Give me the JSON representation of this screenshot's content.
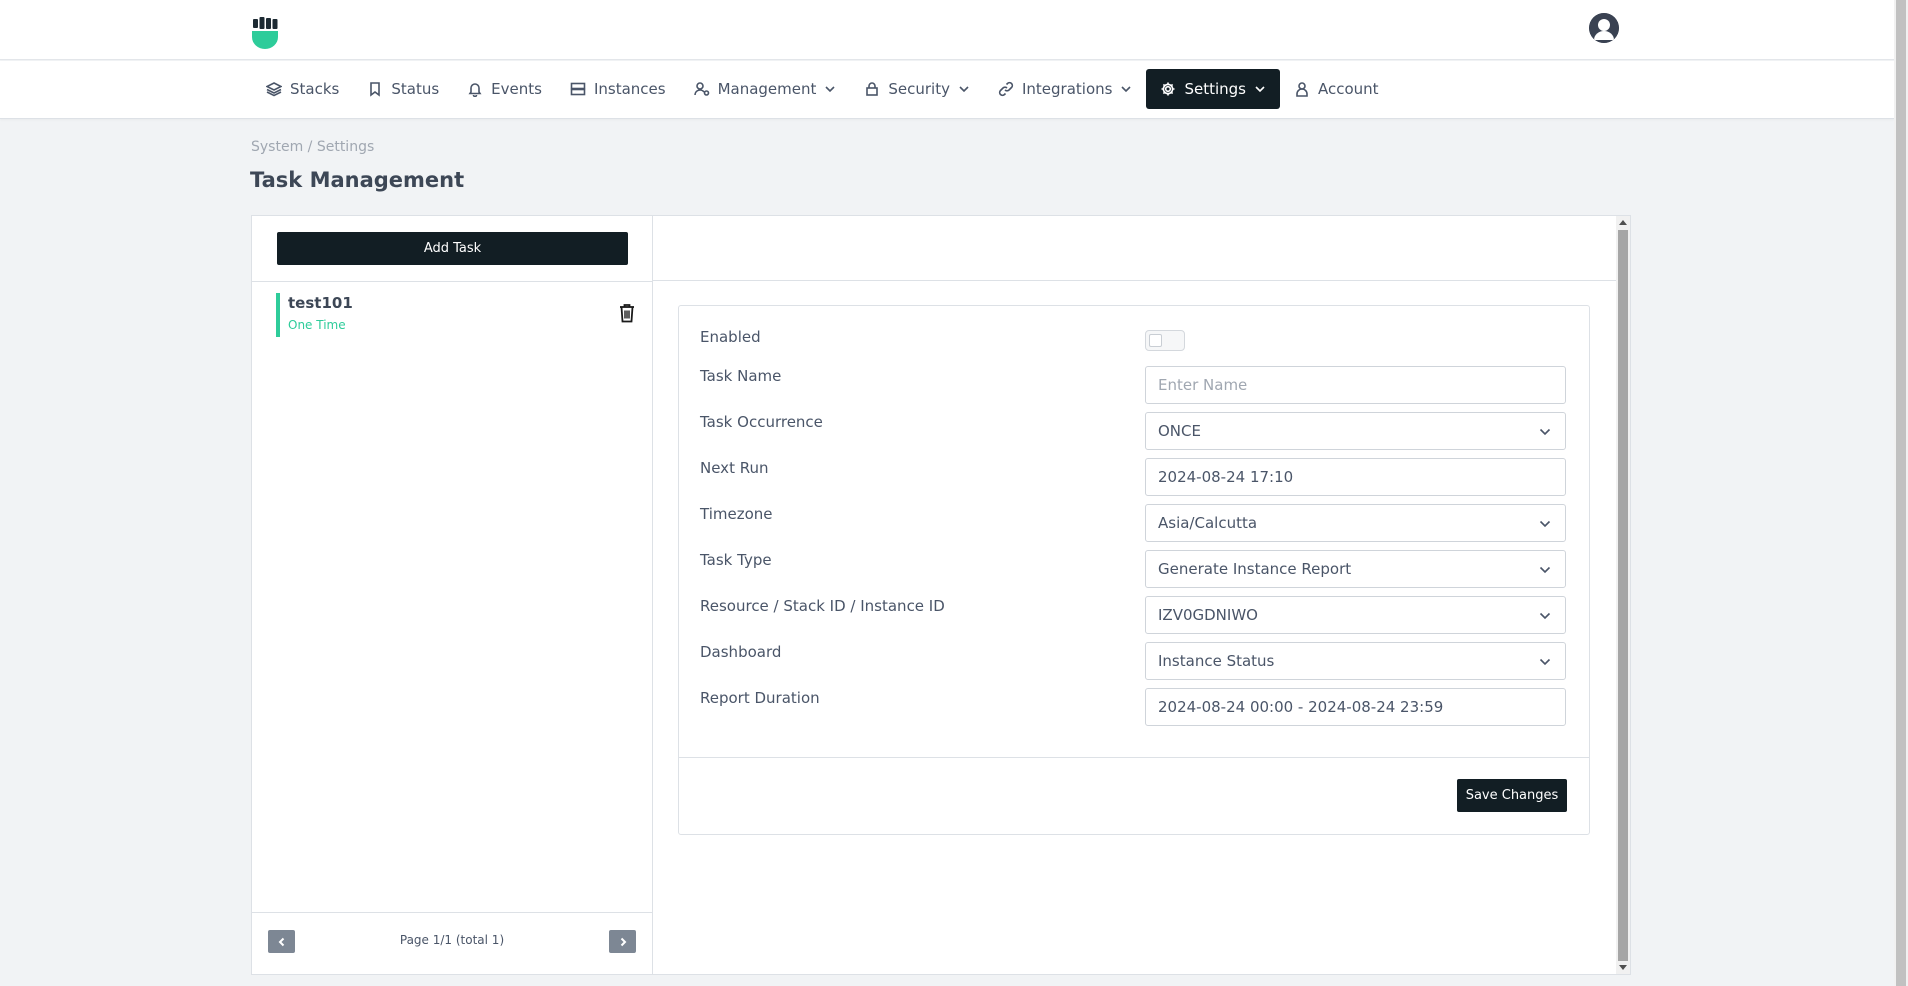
{
  "brand": {
    "logo_icon": "fist-logo-icon",
    "accent": "#2ecc9a",
    "dark": "#121e24"
  },
  "nav": {
    "items": [
      {
        "label": "Stacks",
        "icon": "layers-icon"
      },
      {
        "label": "Status",
        "icon": "bookmark-icon"
      },
      {
        "label": "Events",
        "icon": "bell-icon"
      },
      {
        "label": "Instances",
        "icon": "server-icon"
      },
      {
        "label": "Management",
        "icon": "user-gear-icon"
      },
      {
        "label": "Security",
        "icon": "lock-icon"
      },
      {
        "label": "Integrations",
        "icon": "link-icon"
      },
      {
        "label": "Settings",
        "icon": "gear-icon"
      },
      {
        "label": "Account",
        "icon": "user-icon"
      }
    ],
    "active": "Settings"
  },
  "breadcrumb": "System / Settings",
  "page_title": "Task Management",
  "left": {
    "add_task_label": "Add Task",
    "tasks": [
      {
        "name": "test101",
        "occurrence": "One Time"
      }
    ],
    "pager_text": "Page 1/1 (total 1)"
  },
  "form": {
    "enabled_label": "Enabled",
    "enabled": false,
    "task_name_label": "Task Name",
    "task_name_placeholder": "Enter Name",
    "occurrence_label": "Task Occurrence",
    "occurrence_value": "ONCE",
    "next_run_label": "Next Run",
    "next_run_value": "2024-08-24 17:10",
    "timezone_label": "Timezone",
    "timezone_value": "Asia/Calcutta",
    "task_type_label": "Task Type",
    "task_type_value": "Generate Instance Report",
    "resource_label": "Resource / Stack ID / Instance ID",
    "resource_value": "IZV0GDNIWO",
    "dashboard_label": "Dashboard",
    "dashboard_value": "Instance Status",
    "duration_label": "Report Duration",
    "duration_value": "2024-08-24 00:00 - 2024-08-24 23:59",
    "save_label": "Save Changes"
  }
}
